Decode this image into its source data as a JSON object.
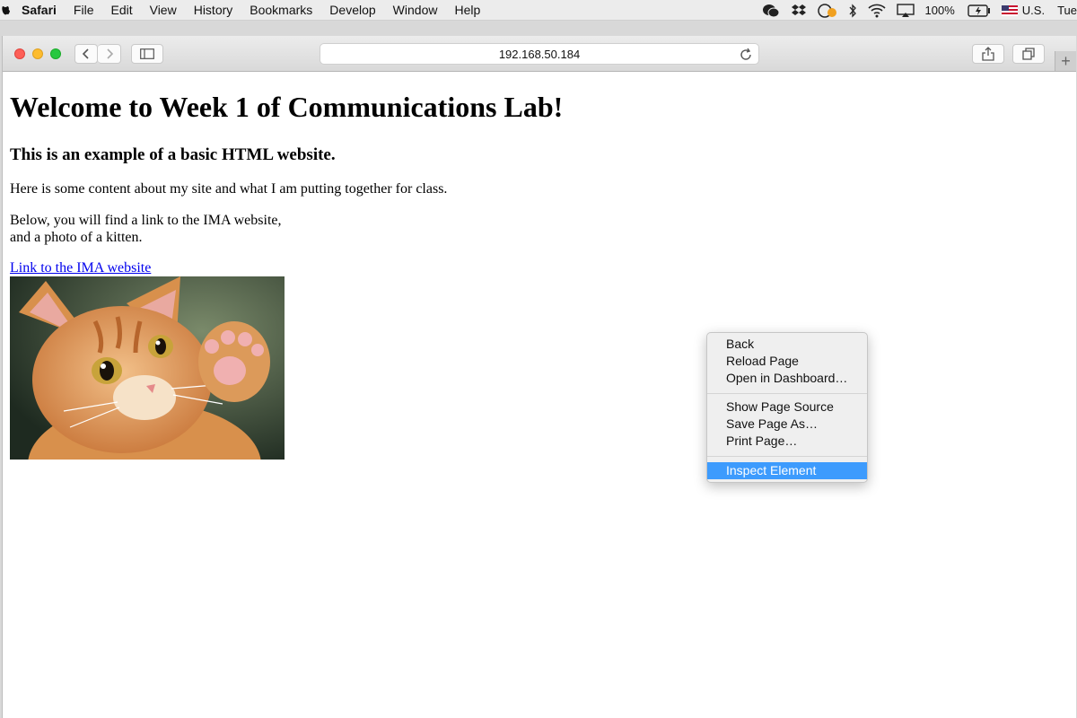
{
  "menubar": {
    "app_name": "Safari",
    "items": [
      "File",
      "Edit",
      "View",
      "History",
      "Bookmarks",
      "Develop",
      "Window",
      "Help"
    ],
    "battery": "100%",
    "input_source": "U.S.",
    "clock": "Tue"
  },
  "browser": {
    "url": "192.168.50.184"
  },
  "page": {
    "heading": "Welcome to Week 1 of Communications Lab!",
    "subheading": "This is an example of a basic HTML website.",
    "paragraph1": "Here is some content about my site and what I am putting together for class.",
    "paragraph2_line1": "Below, you will find a link to the IMA website,",
    "paragraph2_line2": "and a photo of a kitten.",
    "link_text": "Link to the IMA website"
  },
  "context_menu": {
    "groups": [
      [
        "Back",
        "Reload Page",
        "Open in Dashboard…"
      ],
      [
        "Show Page Source",
        "Save Page As…",
        "Print Page…"
      ],
      [
        "Inspect Element"
      ]
    ],
    "highlighted": "Inspect Element",
    "highlight_color": "#3d9bfd"
  }
}
